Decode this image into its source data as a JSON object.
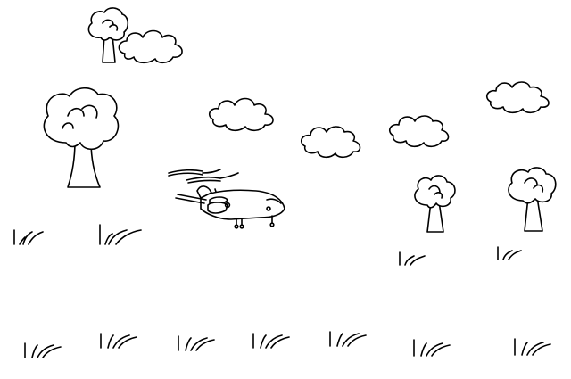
{
  "scene": {
    "background_color": "#ffffff",
    "ink_color": "#000000",
    "sprites": {
      "player": "twin-rotor-helicopter-icon",
      "tree": "tree-icon",
      "cloud": "cloud-icon",
      "grass": "grass-tuft-icon"
    }
  }
}
